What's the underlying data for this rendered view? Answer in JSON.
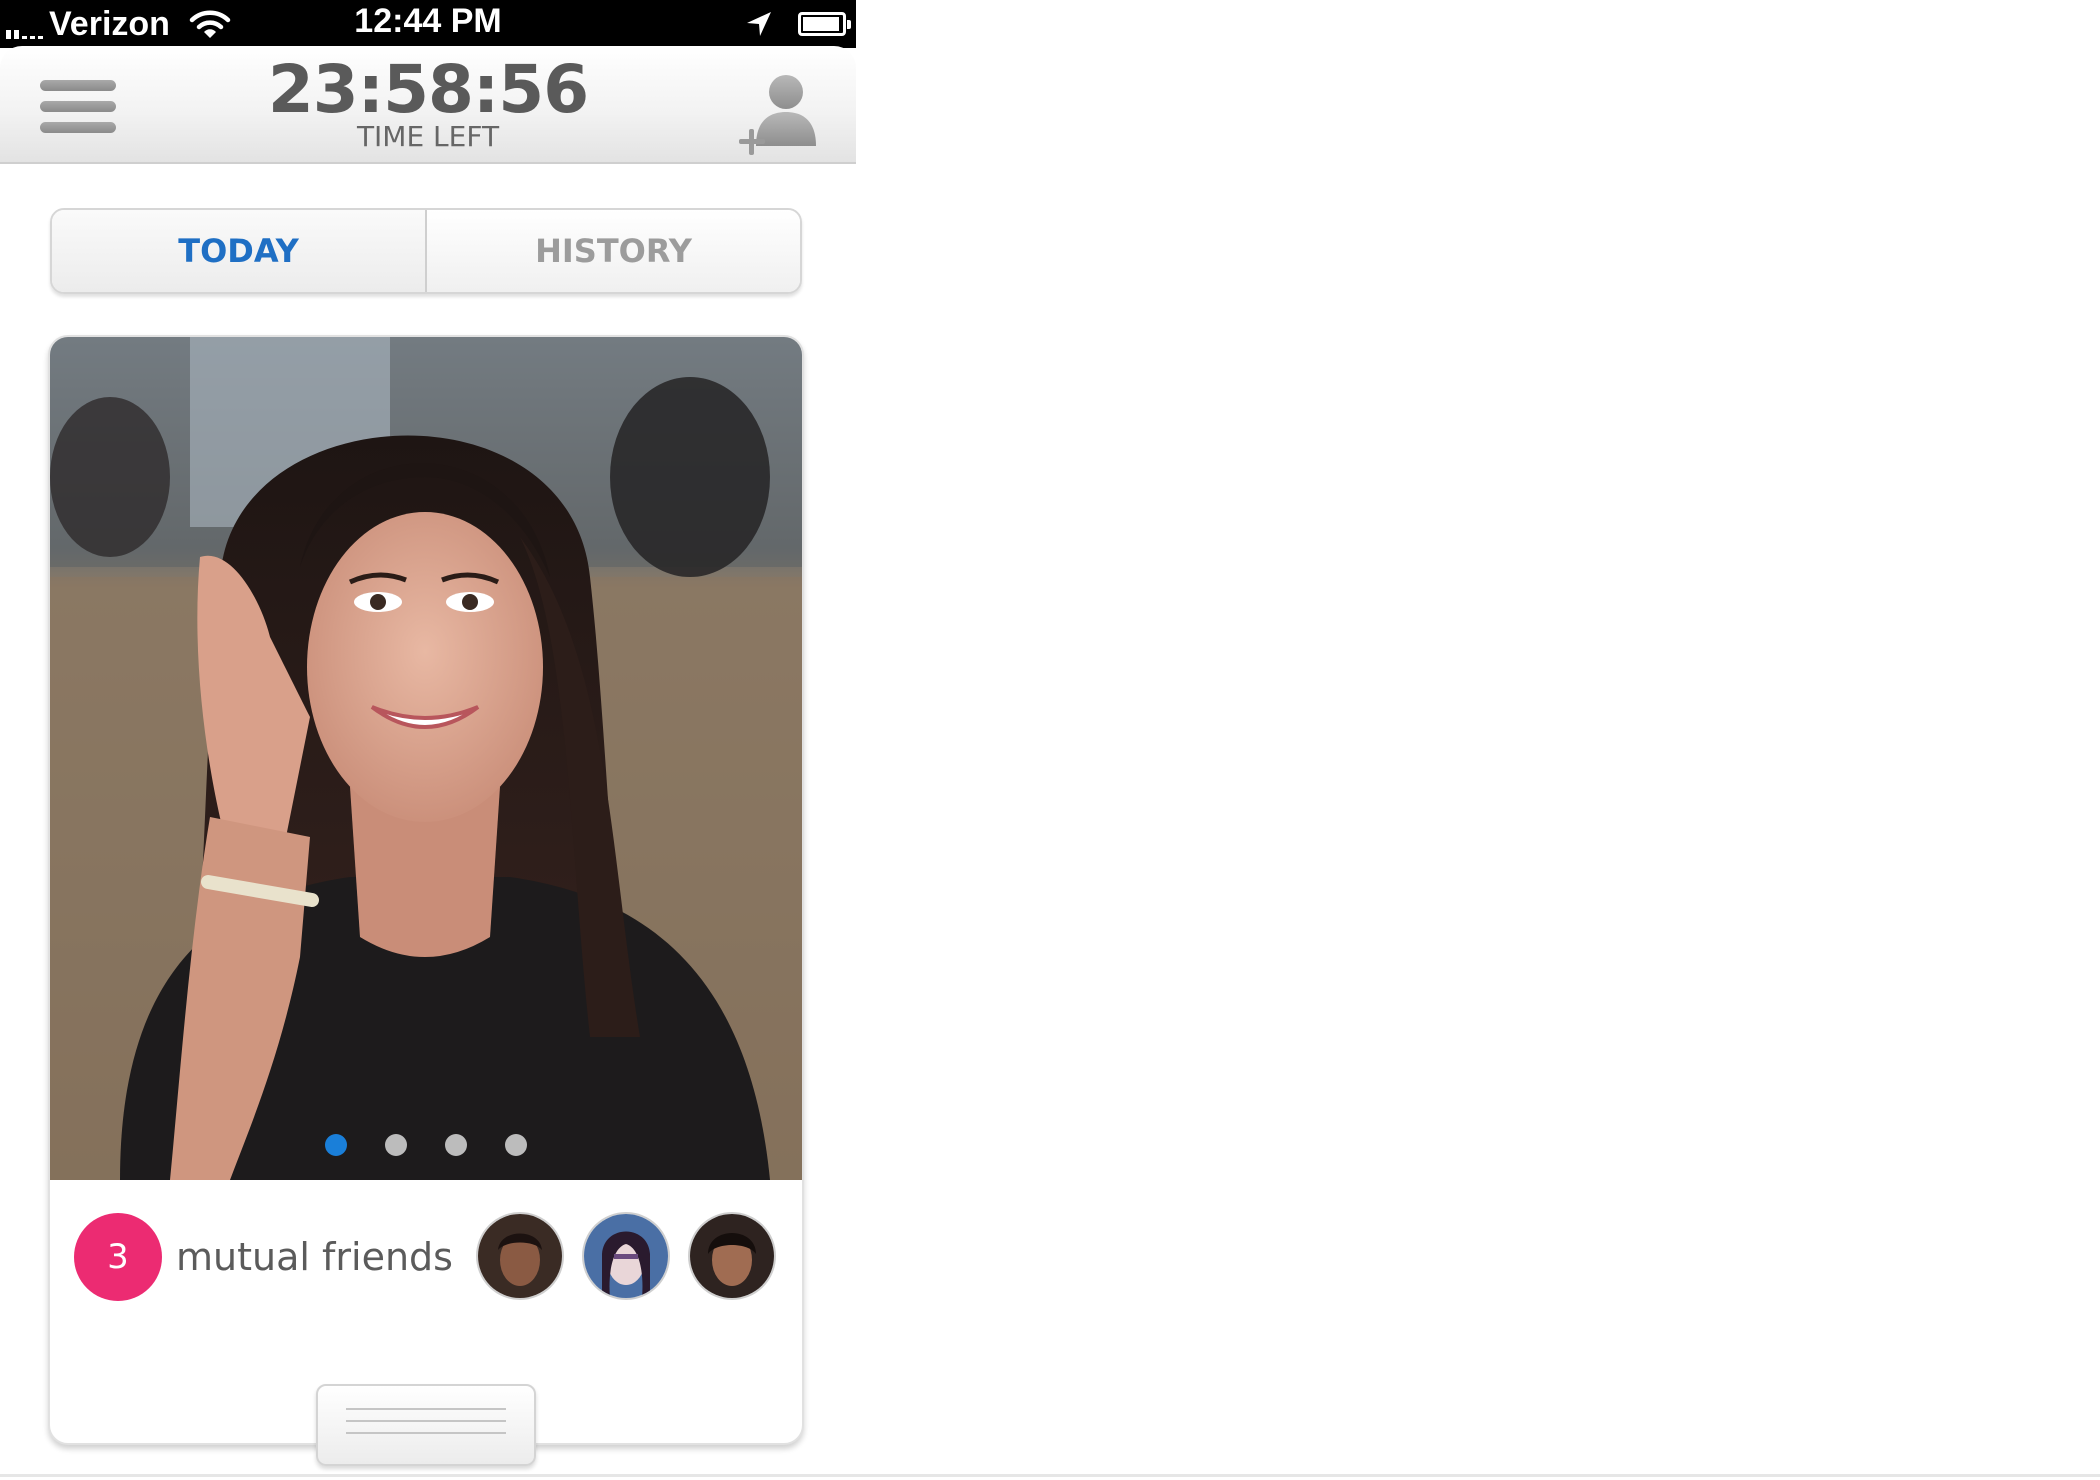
{
  "status_bar": {
    "carrier": "Verizon",
    "time": "12:44 PM",
    "signal_bars_filled": 2,
    "signal_bars_total": 5,
    "battery_level": 0.95
  },
  "header": {
    "countdown": "23:58:56",
    "countdown_label": "TIME LEFT",
    "menu_icon": "hamburger-menu-icon",
    "add_friend_icon": "add-friend-icon"
  },
  "tabs": [
    {
      "label": "TODAY",
      "active": true
    },
    {
      "label": "HISTORY",
      "active": false
    }
  ],
  "profile_card": {
    "photo_page_count": 4,
    "photo_page_current": 1,
    "mutual_friends": {
      "count": "3",
      "label": "mutual friends",
      "avatars": [
        "friend-avatar-1",
        "friend-avatar-2",
        "friend-avatar-3"
      ]
    }
  },
  "colors": {
    "accent_blue": "#1f6fc4",
    "badge_pink": "#ec2b72",
    "inactive_gray": "#9c9c9c"
  }
}
